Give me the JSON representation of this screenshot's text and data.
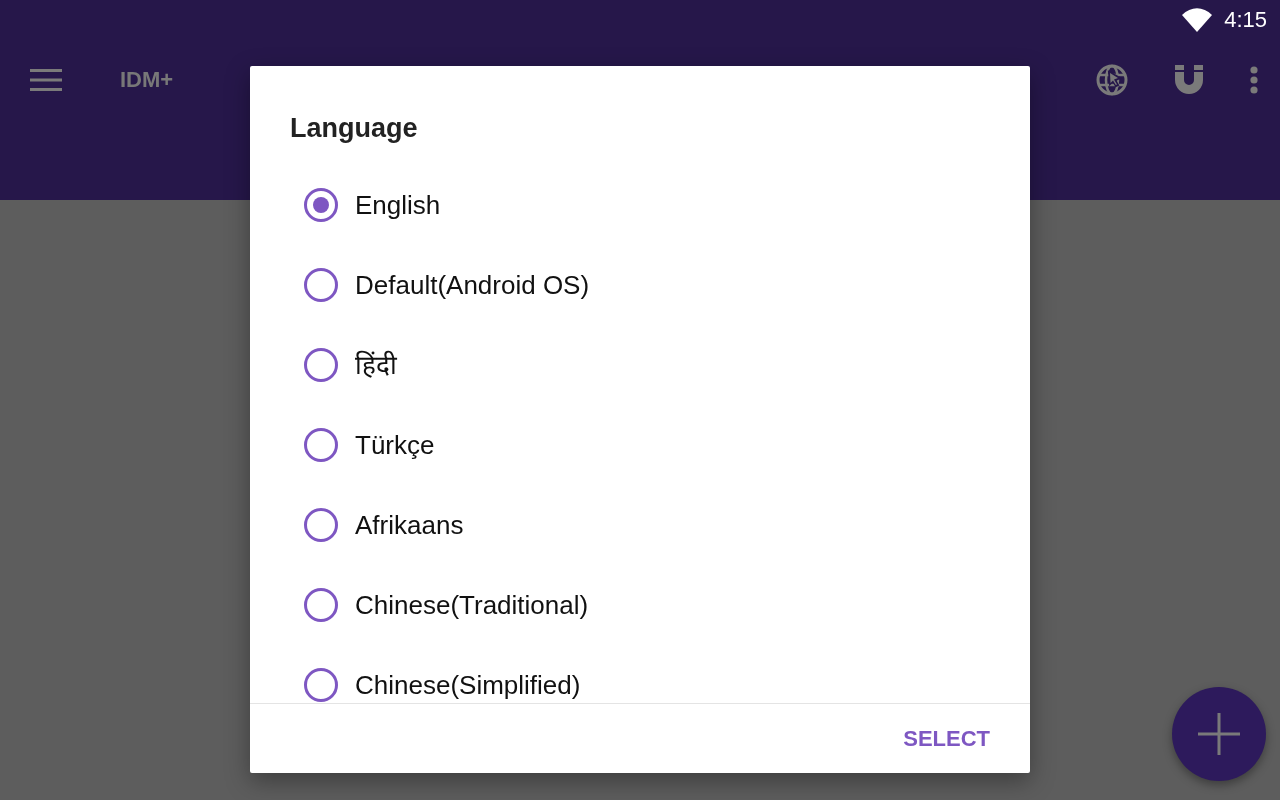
{
  "status_bar": {
    "time": "4:15"
  },
  "app_bar": {
    "title": "IDM+"
  },
  "dialog": {
    "title": "Language",
    "options": [
      {
        "label": "English",
        "selected": true
      },
      {
        "label": "Default(Android OS)",
        "selected": false
      },
      {
        "label": "हिंदी",
        "selected": false
      },
      {
        "label": "Türkçe",
        "selected": false
      },
      {
        "label": "Afrikaans",
        "selected": false
      },
      {
        "label": "Chinese(Traditional)",
        "selected": false
      },
      {
        "label": "Chinese(Simplified)",
        "selected": false
      }
    ],
    "button": "SELECT"
  }
}
